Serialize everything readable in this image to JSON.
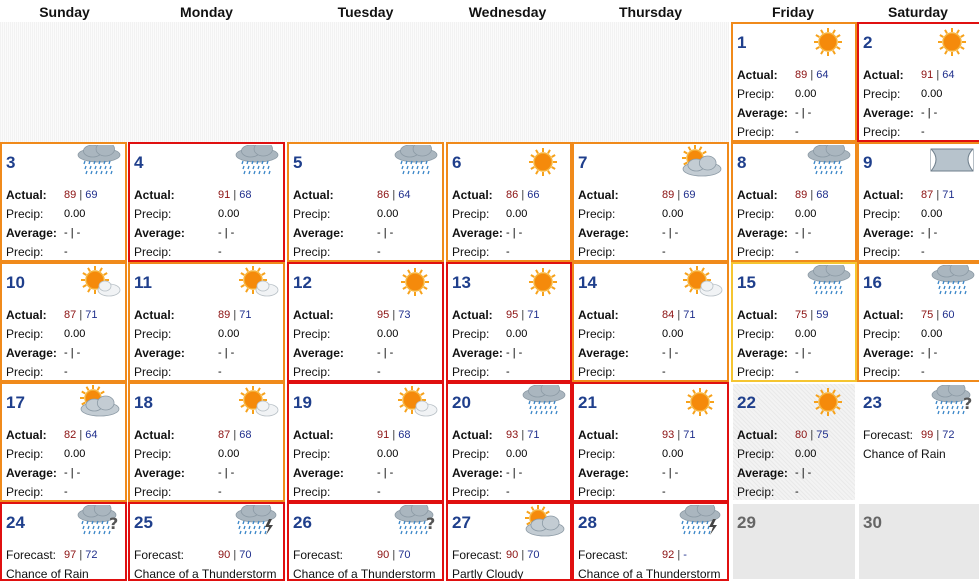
{
  "days_of_week": [
    "Sunday",
    "Monday",
    "Tuesday",
    "Wednesday",
    "Thursday",
    "Friday",
    "Saturday"
  ],
  "labels": {
    "actual": "Actual:",
    "precip": "Precip:",
    "average": "Average:",
    "forecast": "Forecast:",
    "avg_value": "- | -",
    "precip_avg_value": "-"
  },
  "days": [
    {
      "day": "1",
      "type": "actual",
      "hi": "89",
      "lo": "64",
      "precip": "0.00",
      "icon": "sunny-icon",
      "border": "orange"
    },
    {
      "day": "2",
      "type": "actual",
      "hi": "91",
      "lo": "64",
      "precip": "0.00",
      "icon": "sunny-icon",
      "border": "red"
    },
    {
      "day": "3",
      "type": "actual",
      "hi": "89",
      "lo": "69",
      "precip": "0.00",
      "icon": "rain-icon",
      "border": "orange"
    },
    {
      "day": "4",
      "type": "actual",
      "hi": "91",
      "lo": "68",
      "precip": "0.00",
      "icon": "rain-icon",
      "border": "red"
    },
    {
      "day": "5",
      "type": "actual",
      "hi": "86",
      "lo": "64",
      "precip": "0.00",
      "icon": "rain-icon",
      "border": "orange"
    },
    {
      "day": "6",
      "type": "actual",
      "hi": "86",
      "lo": "66",
      "precip": "0.00",
      "icon": "sunny-icon",
      "border": "orange"
    },
    {
      "day": "7",
      "type": "actual",
      "hi": "89",
      "lo": "69",
      "precip": "0.00",
      "icon": "partly-cloudy-icon",
      "border": "orange"
    },
    {
      "day": "8",
      "type": "actual",
      "hi": "89",
      "lo": "68",
      "precip": "0.00",
      "icon": "rain-icon",
      "border": "orange"
    },
    {
      "day": "9",
      "type": "actual",
      "hi": "87",
      "lo": "71",
      "precip": "0.00",
      "icon": "cloudy-icon",
      "border": "orange"
    },
    {
      "day": "10",
      "type": "actual",
      "hi": "87",
      "lo": "71",
      "precip": "0.00",
      "icon": "mostly-sunny-icon",
      "border": "orange"
    },
    {
      "day": "11",
      "type": "actual",
      "hi": "89",
      "lo": "71",
      "precip": "0.00",
      "icon": "mostly-sunny-icon",
      "border": "orange"
    },
    {
      "day": "12",
      "type": "actual",
      "hi": "95",
      "lo": "73",
      "precip": "0.00",
      "icon": "sunny-icon",
      "border": "red"
    },
    {
      "day": "13",
      "type": "actual",
      "hi": "95",
      "lo": "71",
      "precip": "0.00",
      "icon": "sunny-icon",
      "border": "red"
    },
    {
      "day": "14",
      "type": "actual",
      "hi": "84",
      "lo": "71",
      "precip": "0.00",
      "icon": "mostly-sunny-icon",
      "border": "orange"
    },
    {
      "day": "15",
      "type": "actual",
      "hi": "75",
      "lo": "59",
      "precip": "0.00",
      "icon": "rain-icon",
      "border": "yellow"
    },
    {
      "day": "16",
      "type": "actual",
      "hi": "75",
      "lo": "60",
      "precip": "0.00",
      "icon": "rain-icon",
      "border": "orange"
    },
    {
      "day": "17",
      "type": "actual",
      "hi": "82",
      "lo": "64",
      "precip": "0.00",
      "icon": "partly-cloudy-icon",
      "border": "orange"
    },
    {
      "day": "18",
      "type": "actual",
      "hi": "87",
      "lo": "68",
      "precip": "0.00",
      "icon": "mostly-sunny-icon",
      "border": "orange"
    },
    {
      "day": "19",
      "type": "actual",
      "hi": "91",
      "lo": "68",
      "precip": "0.00",
      "icon": "mostly-sunny-icon",
      "border": "red"
    },
    {
      "day": "20",
      "type": "actual",
      "hi": "93",
      "lo": "71",
      "precip": "0.00",
      "icon": "rain-icon",
      "border": "red"
    },
    {
      "day": "21",
      "type": "actual",
      "hi": "93",
      "lo": "71",
      "precip": "0.00",
      "icon": "sunny-icon",
      "border": "red"
    },
    {
      "day": "22",
      "type": "actual",
      "hi": "80",
      "lo": "75",
      "precip": "0.00",
      "icon": "sunny-icon",
      "border": "none",
      "shaded": true
    },
    {
      "day": "23",
      "type": "forecast",
      "hi": "99",
      "lo": "72",
      "condition": "Chance of Rain",
      "icon": "chance-rain-icon",
      "border": "none"
    },
    {
      "day": "24",
      "type": "forecast",
      "hi": "97",
      "lo": "72",
      "condition": "Chance of Rain",
      "icon": "chance-rain-icon",
      "border": "red"
    },
    {
      "day": "25",
      "type": "forecast",
      "hi": "90",
      "lo": "70",
      "condition": "Chance of a Thunderstorm",
      "icon": "thunderstorm-icon",
      "border": "red"
    },
    {
      "day": "26",
      "type": "forecast",
      "hi": "90",
      "lo": "70",
      "condition": "Chance of a Thunderstorm",
      "icon": "chance-rain-icon",
      "border": "red"
    },
    {
      "day": "27",
      "type": "forecast",
      "hi": "90",
      "lo": "70",
      "condition": "Partly Cloudy",
      "icon": "partly-cloudy-icon",
      "border": "red"
    },
    {
      "day": "28",
      "type": "forecast",
      "hi": "92",
      "lo": "-",
      "condition": "Chance of a Thunderstorm",
      "icon": "thunderstorm-icon",
      "border": "red"
    },
    {
      "day": "29",
      "type": "empty"
    },
    {
      "day": "30",
      "type": "empty"
    }
  ],
  "colors": {
    "orange": "#f08a1b",
    "red": "#e01010",
    "yellow": "#f5c531",
    "hi": "#8b1010",
    "lo": "#1f2f8c",
    "daynum": "#1f3f8c"
  }
}
